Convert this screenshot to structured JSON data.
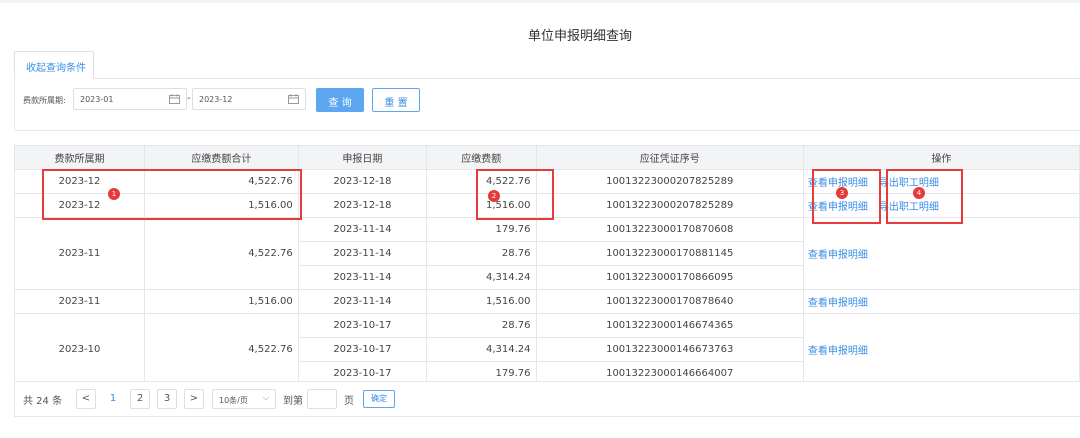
{
  "page": {
    "title": "单位申报明细查询"
  },
  "filter": {
    "tab_label": "收起查询条件",
    "period_label": "费款所属期:",
    "start_value": "2023-01",
    "dash": "-",
    "end_value": "2023-12",
    "query_button": "查 询",
    "reset_button": "重 置"
  },
  "table": {
    "headers": [
      "费款所属期",
      "应缴费额合计",
      "申报日期",
      "应缴费额",
      "应征凭证序号",
      "操作"
    ],
    "groups": [
      {
        "period": "2023-12",
        "total": "4,522.76",
        "rows": [
          {
            "date": "2023-12-18",
            "amount": "4,522.76",
            "voucher": "10013223000207825289"
          }
        ],
        "op_view": "查看申报明细",
        "op_export": "导出职工明细"
      },
      {
        "period": "2023-12",
        "total": "1,516.00",
        "rows": [
          {
            "date": "2023-12-18",
            "amount": "1,516.00",
            "voucher": "10013223000207825289"
          }
        ],
        "op_view": "查看申报明细",
        "op_export": "导出职工明细"
      },
      {
        "period": "2023-11",
        "total": "4,522.76",
        "rows": [
          {
            "date": "2023-11-14",
            "amount": "179.76",
            "voucher": "10013223000170870608"
          },
          {
            "date": "2023-11-14",
            "amount": "28.76",
            "voucher": "10013223000170881145"
          },
          {
            "date": "2023-11-14",
            "amount": "4,314.24",
            "voucher": "10013223000170866095"
          }
        ],
        "op_view": "查看申报明细"
      },
      {
        "period": "2023-11",
        "total": "1,516.00",
        "rows": [
          {
            "date": "2023-11-14",
            "amount": "1,516.00",
            "voucher": "10013223000170878640"
          }
        ],
        "op_view": "查看申报明细"
      },
      {
        "period": "2023-10",
        "total": "4,522.76",
        "rows": [
          {
            "date": "2023-10-17",
            "amount": "28.76",
            "voucher": "10013223000146674365"
          },
          {
            "date": "2023-10-17",
            "amount": "4,314.24",
            "voucher": "10013223000146673763"
          },
          {
            "date": "2023-10-17",
            "amount": "179.76",
            "voucher": "10013223000146664007"
          }
        ],
        "op_view": "查看申报明细"
      }
    ]
  },
  "annotations": {
    "badges": [
      "1",
      "2",
      "3",
      "4"
    ],
    "color": "#e63b3b"
  },
  "pagination": {
    "total_text": "共 24 条",
    "prev": "<",
    "pages": [
      "1",
      "2",
      "3"
    ],
    "next": ">",
    "page_size": "10条/页",
    "goto_label": "到第",
    "page_label": "页",
    "confirm": "确定"
  },
  "colors": {
    "accent": "#3a8ee6",
    "button": "#5ca7f0",
    "header_bg": "#f3f4f6"
  }
}
